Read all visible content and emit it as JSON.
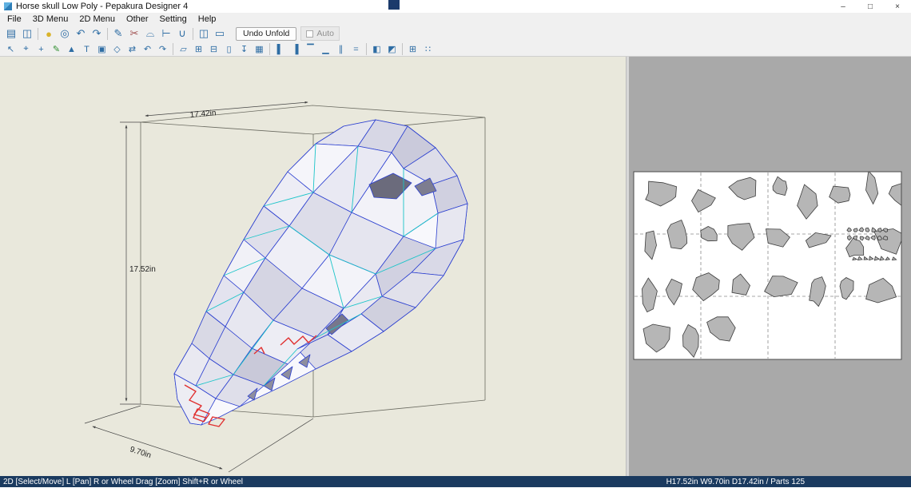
{
  "window": {
    "title": "Horse skull Low Poly - Pepakura Designer 4",
    "buttons": [
      {
        "name": "minimize-button",
        "glyph": "–"
      },
      {
        "name": "maximize-button",
        "glyph": "□"
      },
      {
        "name": "close-button",
        "glyph": "×"
      }
    ]
  },
  "menu": {
    "items": [
      {
        "name": "menu-file",
        "label": "File"
      },
      {
        "name": "menu-3d",
        "label": "3D Menu"
      },
      {
        "name": "menu-2d",
        "label": "2D Menu"
      },
      {
        "name": "menu-other",
        "label": "Other"
      },
      {
        "name": "menu-setting",
        "label": "Setting"
      },
      {
        "name": "menu-help",
        "label": "Help"
      }
    ]
  },
  "toolbar_top": {
    "icons": [
      {
        "name": "open-file-icon",
        "glyph": "▤"
      },
      {
        "name": "save-icon",
        "glyph": "◫"
      },
      {
        "name": "toolbar-separator",
        "glyph": ""
      },
      {
        "name": "bulb-icon",
        "glyph": "●"
      },
      {
        "name": "texture-view-icon",
        "glyph": "◎"
      },
      {
        "name": "rotate-left-icon",
        "glyph": "↶"
      },
      {
        "name": "rotate-right-icon",
        "glyph": "↷"
      },
      {
        "name": "toolbar-separator",
        "glyph": ""
      },
      {
        "name": "pen-icon",
        "glyph": "✎"
      },
      {
        "name": "scissors-icon",
        "glyph": "✂"
      },
      {
        "name": "protractor-icon",
        "glyph": "⌓"
      },
      {
        "name": "measure-icon",
        "glyph": "⊢"
      },
      {
        "name": "magnet-icon",
        "glyph": "∪"
      },
      {
        "name": "toolbar-separator",
        "glyph": ""
      },
      {
        "name": "layout-both-panes-icon",
        "glyph": "◫"
      },
      {
        "name": "layout-single-pane-icon",
        "glyph": "▭"
      }
    ],
    "undo_unfold_label": "Undo Unfold",
    "auto_label": "Auto"
  },
  "toolbar_edit": {
    "icons": [
      {
        "name": "select-arrow-icon",
        "glyph": "↖"
      },
      {
        "name": "zoom-icon",
        "glyph": "⌖"
      },
      {
        "name": "pan-icon",
        "glyph": "+"
      },
      {
        "name": "edge-pen-icon",
        "glyph": "✎"
      },
      {
        "name": "highlight-icon",
        "glyph": "▲"
      },
      {
        "name": "text-icon",
        "glyph": "T"
      },
      {
        "name": "image-icon",
        "glyph": "▣"
      },
      {
        "name": "cube-icon",
        "glyph": "◇"
      },
      {
        "name": "sync-icon",
        "glyph": "⇄"
      },
      {
        "name": "undo-icon",
        "glyph": "↶"
      },
      {
        "name": "redo-icon",
        "glyph": "↷"
      },
      {
        "name": "toolbar-separator",
        "glyph": ""
      },
      {
        "name": "pages-icon",
        "glyph": "▱"
      },
      {
        "name": "arrange-parts-icon",
        "glyph": "⊞"
      },
      {
        "name": "join-edge-icon",
        "glyph": "⊟"
      },
      {
        "name": "page-icon",
        "glyph": "▯"
      },
      {
        "name": "export-icon",
        "glyph": "↧"
      },
      {
        "name": "print-icon",
        "glyph": "▦"
      },
      {
        "name": "toolbar-separator",
        "glyph": ""
      },
      {
        "name": "align-left-icon",
        "glyph": "▌"
      },
      {
        "name": "align-right-icon",
        "glyph": "▐"
      },
      {
        "name": "align-top-icon",
        "glyph": "▔"
      },
      {
        "name": "align-bottom-icon",
        "glyph": "▁"
      },
      {
        "name": "distribute-horizontal-icon",
        "glyph": "∥"
      },
      {
        "name": "distribute-vertical-icon",
        "glyph": "="
      },
      {
        "name": "toolbar-separator",
        "glyph": ""
      },
      {
        "name": "flip-horizontal-icon",
        "glyph": "◧"
      },
      {
        "name": "flip-vertical-icon",
        "glyph": "◩"
      },
      {
        "name": "toolbar-separator",
        "glyph": ""
      },
      {
        "name": "grid-icon",
        "glyph": "⊞"
      },
      {
        "name": "snap-icon",
        "glyph": "∷"
      }
    ]
  },
  "viewport3d": {
    "dim_top": "17.42in",
    "dim_left": "17.52in",
    "dim_bottom": "9.70in"
  },
  "statusbar": {
    "left": "2D [Select/Move] L [Pan] R or Wheel Drag [Zoom] Shift+R or Wheel",
    "right": "H17.52in W9.70in D17.42in / Parts 125"
  },
  "colors": {
    "status_bg": "#1a3a5f",
    "edge_blue": "#2b3fd0",
    "fold_cyan": "#1ac4c8",
    "open_edge_red": "#e03030",
    "view3d_bg": "#e9e8dc",
    "view2d_bg": "#a9a9a9"
  }
}
